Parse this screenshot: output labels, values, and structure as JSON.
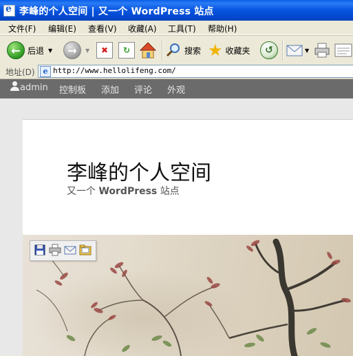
{
  "window": {
    "title": "李峰的个人空间 | 又一个 WordPress 站点"
  },
  "menu": [
    "文件(F)",
    "编辑(E)",
    "查看(V)",
    "收藏(A)",
    "工具(T)",
    "帮助(H)"
  ],
  "toolbar": {
    "back": "后退",
    "search": "搜索",
    "favorites": "收藏夹"
  },
  "address": {
    "label": "地址(D)",
    "url": "http://www.hellolifeng.com/"
  },
  "adminbar": {
    "user": "admin",
    "items": [
      "控制板",
      "添加",
      "评论",
      "外观"
    ]
  },
  "site": {
    "title": "李峰的个人空间",
    "desc_prefix": "又一个",
    "desc_brand": "WordPress",
    "desc_suffix": "站点"
  }
}
